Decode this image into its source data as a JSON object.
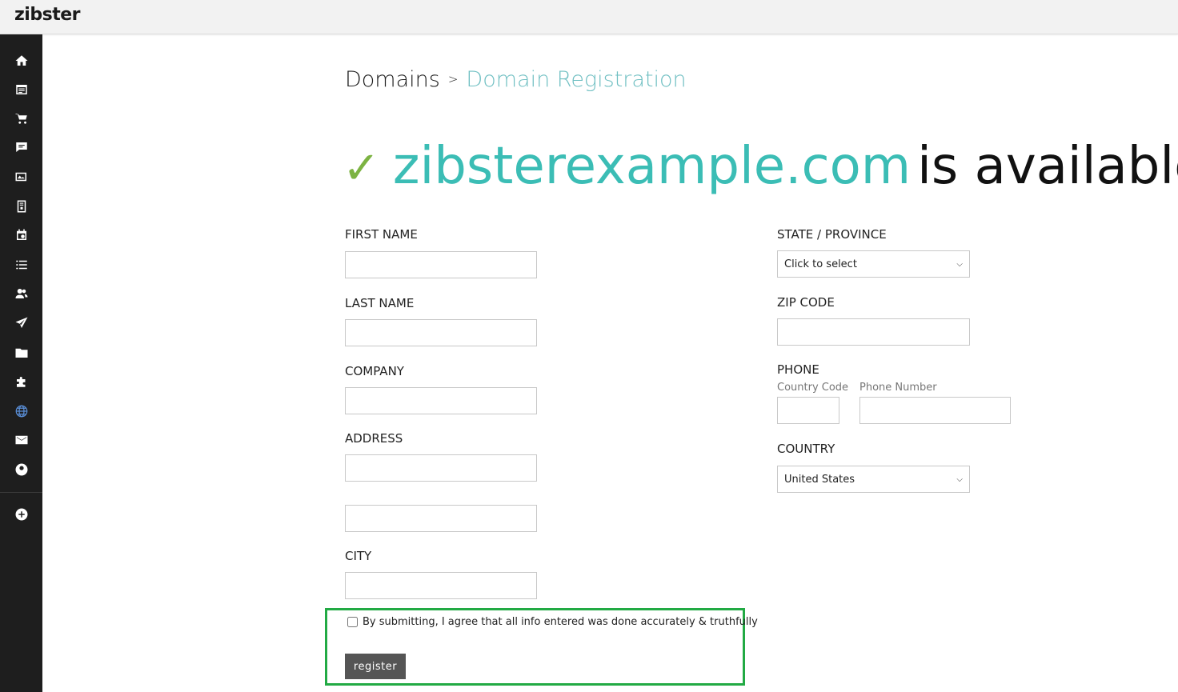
{
  "app": {
    "logo_text": "zibster"
  },
  "sidebar": {
    "items": [
      {
        "icon": "home-icon"
      },
      {
        "icon": "calendar-list-icon"
      },
      {
        "icon": "cart-icon"
      },
      {
        "icon": "chat-icon"
      },
      {
        "icon": "gallery-icon"
      },
      {
        "icon": "invoice-icon"
      },
      {
        "icon": "events-icon"
      },
      {
        "icon": "list-icon"
      },
      {
        "icon": "users-icon"
      },
      {
        "icon": "send-icon"
      },
      {
        "icon": "folder-icon"
      },
      {
        "icon": "puzzle-icon"
      },
      {
        "icon": "globe-icon"
      },
      {
        "icon": "mail-icon"
      },
      {
        "icon": "account-icon"
      },
      {
        "icon": "add-circle-icon"
      }
    ]
  },
  "breadcrumb": {
    "root": "Domains",
    "separator": ">",
    "current": "Domain Registration"
  },
  "headline": {
    "check": "✓",
    "domain": "zibsterexample.com",
    "status": "is available"
  },
  "form": {
    "first_name_label": "FIRST NAME",
    "last_name_label": "LAST NAME",
    "company_label": "COMPANY",
    "address_label": "ADDRESS",
    "city_label": "CITY",
    "state_label": "STATE / PROVINCE",
    "state_value": "Click to select",
    "zip_label": "ZIP CODE",
    "phone_label": "PHONE",
    "country_code_label": "Country Code",
    "phone_number_label": "Phone Number",
    "country_label": "COUNTRY",
    "country_value": "United States",
    "agree_text": "By submitting, I agree that all info entered was done accurately & truthfully",
    "register_label": "register"
  },
  "colors": {
    "accent_teal": "#3bbdb5",
    "breadcrumb_teal": "#6fbfc2",
    "check_green": "#7cb342",
    "highlight_green": "#22aa44",
    "sidebar_bg": "#1e1e1e"
  }
}
